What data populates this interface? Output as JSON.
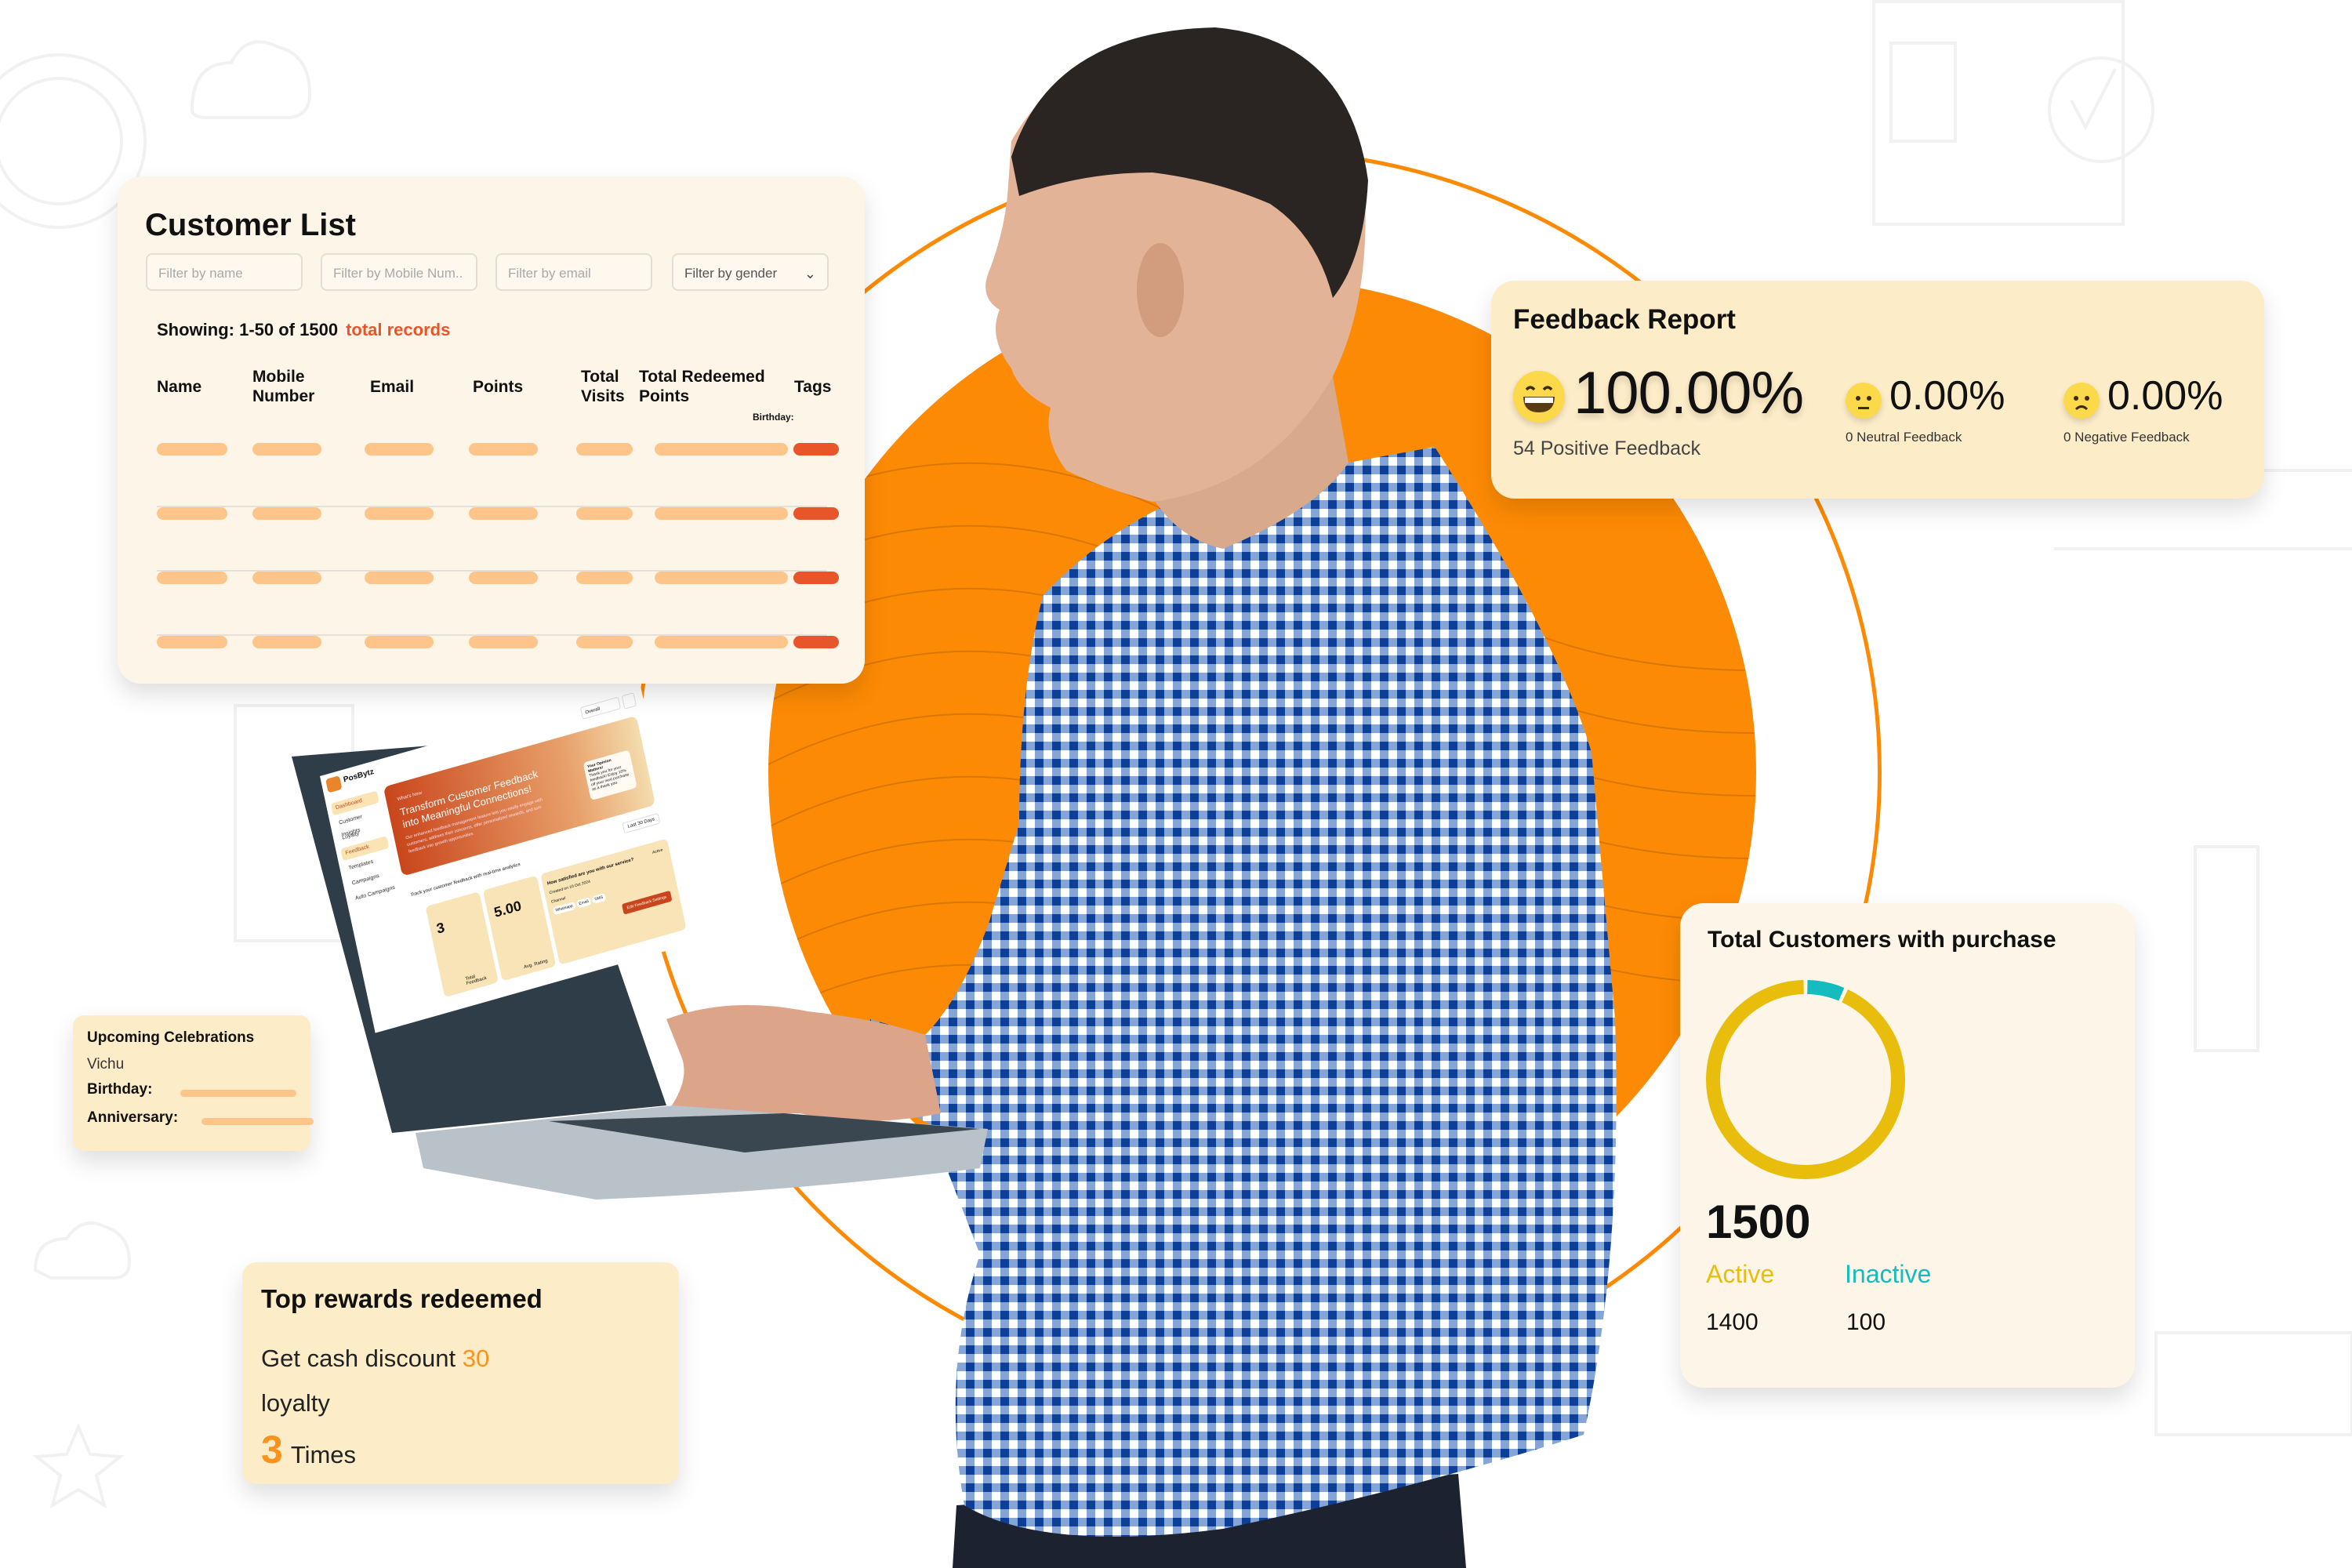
{
  "customer_list": {
    "title": "Customer List",
    "filters": {
      "name_placeholder": "Filter by name",
      "mobile_placeholder": "Filter by Mobile Num..",
      "email_placeholder": "Filter by email",
      "gender_selected": "Filter by gender"
    },
    "showing": "Showing: 1-50 of 1500",
    "showing_suffix": "total records",
    "columns": [
      "Name",
      "Mobile Number",
      "Email",
      "Points",
      "Total Visits",
      "Total Redeemed Points",
      "Tags"
    ],
    "tag_sublabel": "Birthday:",
    "row_count": 4
  },
  "feedback_report": {
    "title": "Feedback Report",
    "positive": {
      "percent": "100.00%",
      "label": "54 Positive Feedback",
      "icon": "grinning-face-icon"
    },
    "neutral": {
      "percent": "0.00%",
      "label": "0 Neutral Feedback",
      "icon": "neutral-face-icon"
    },
    "negative": {
      "percent": "0.00%",
      "label": "0 Negative Feedback",
      "icon": "frowning-face-icon"
    }
  },
  "total_customers": {
    "title": "Total Customers with purchase",
    "total": "1500",
    "active_label": "Active",
    "active_value": "1400",
    "inactive_label": "Inactive",
    "inactive_value": "100",
    "colors": {
      "active": "#e8bd0c",
      "inactive": "#14bcbf"
    }
  },
  "chart_data": {
    "type": "pie",
    "title": "Total Customers with purchase",
    "categories": [
      "Active",
      "Inactive"
    ],
    "values": [
      1400,
      100
    ],
    "total": 1500,
    "donut": true,
    "legend": "bottom"
  },
  "upcoming_celebrations": {
    "title": "Upcoming Celebrations",
    "name": "Vichu",
    "birthday_label": "Birthday:",
    "anniversary_label": "Anniversary:"
  },
  "top_rewards": {
    "title": "Top rewards redeemed",
    "reward_text": "Get cash discount",
    "reward_amount": "30",
    "reward_type": "loyalty",
    "times_count": "3",
    "times_label": "Times"
  },
  "laptop_screen": {
    "brand": "PosBytz",
    "nav": [
      "Dashboard",
      "Customer Insights",
      "Loyalty",
      "Feedback",
      "Templates",
      "Campaigns",
      "Auto Campaigns"
    ],
    "active_nav": "Feedback",
    "outlet_select": "Overall",
    "banner_kicker": "What's New",
    "banner_title": "Transform Customer Feedback into Meaningful Connections!",
    "banner_text": "Our enhanced feedback management feature lets you easily engage with customers, address their concerns, offer personalized rewards, and turn feedback into growth opportunities.",
    "popup_title": "Your Opinion Matters!",
    "popup_text": "Thank you for your feedback! Enjoy 10% off your next purchase as a thank you.",
    "track_text": "Track your customer feedback with real-time analytics",
    "date_range": "Last 30 Days",
    "stats": [
      {
        "value": "3",
        "label": "Total Feedback"
      },
      {
        "value": "5.00",
        "label": "Avg. Rating"
      }
    ],
    "survey_question": "How satisfied are you with our service?",
    "survey_created": "Created on 10 Oct 2024",
    "survey_channel_label": "Channel",
    "channels": [
      "Whatsapp",
      "Email",
      "SMS"
    ],
    "survey_status": "Active",
    "edit_button": "Edit Feedback Settings"
  },
  "colors": {
    "brand_orange": "#fd8a04",
    "accent_red": "#e8552a",
    "placeholder_bar": "#fec58a",
    "card_cream": "#fef5e9",
    "card_peach": "#fdecc8"
  }
}
